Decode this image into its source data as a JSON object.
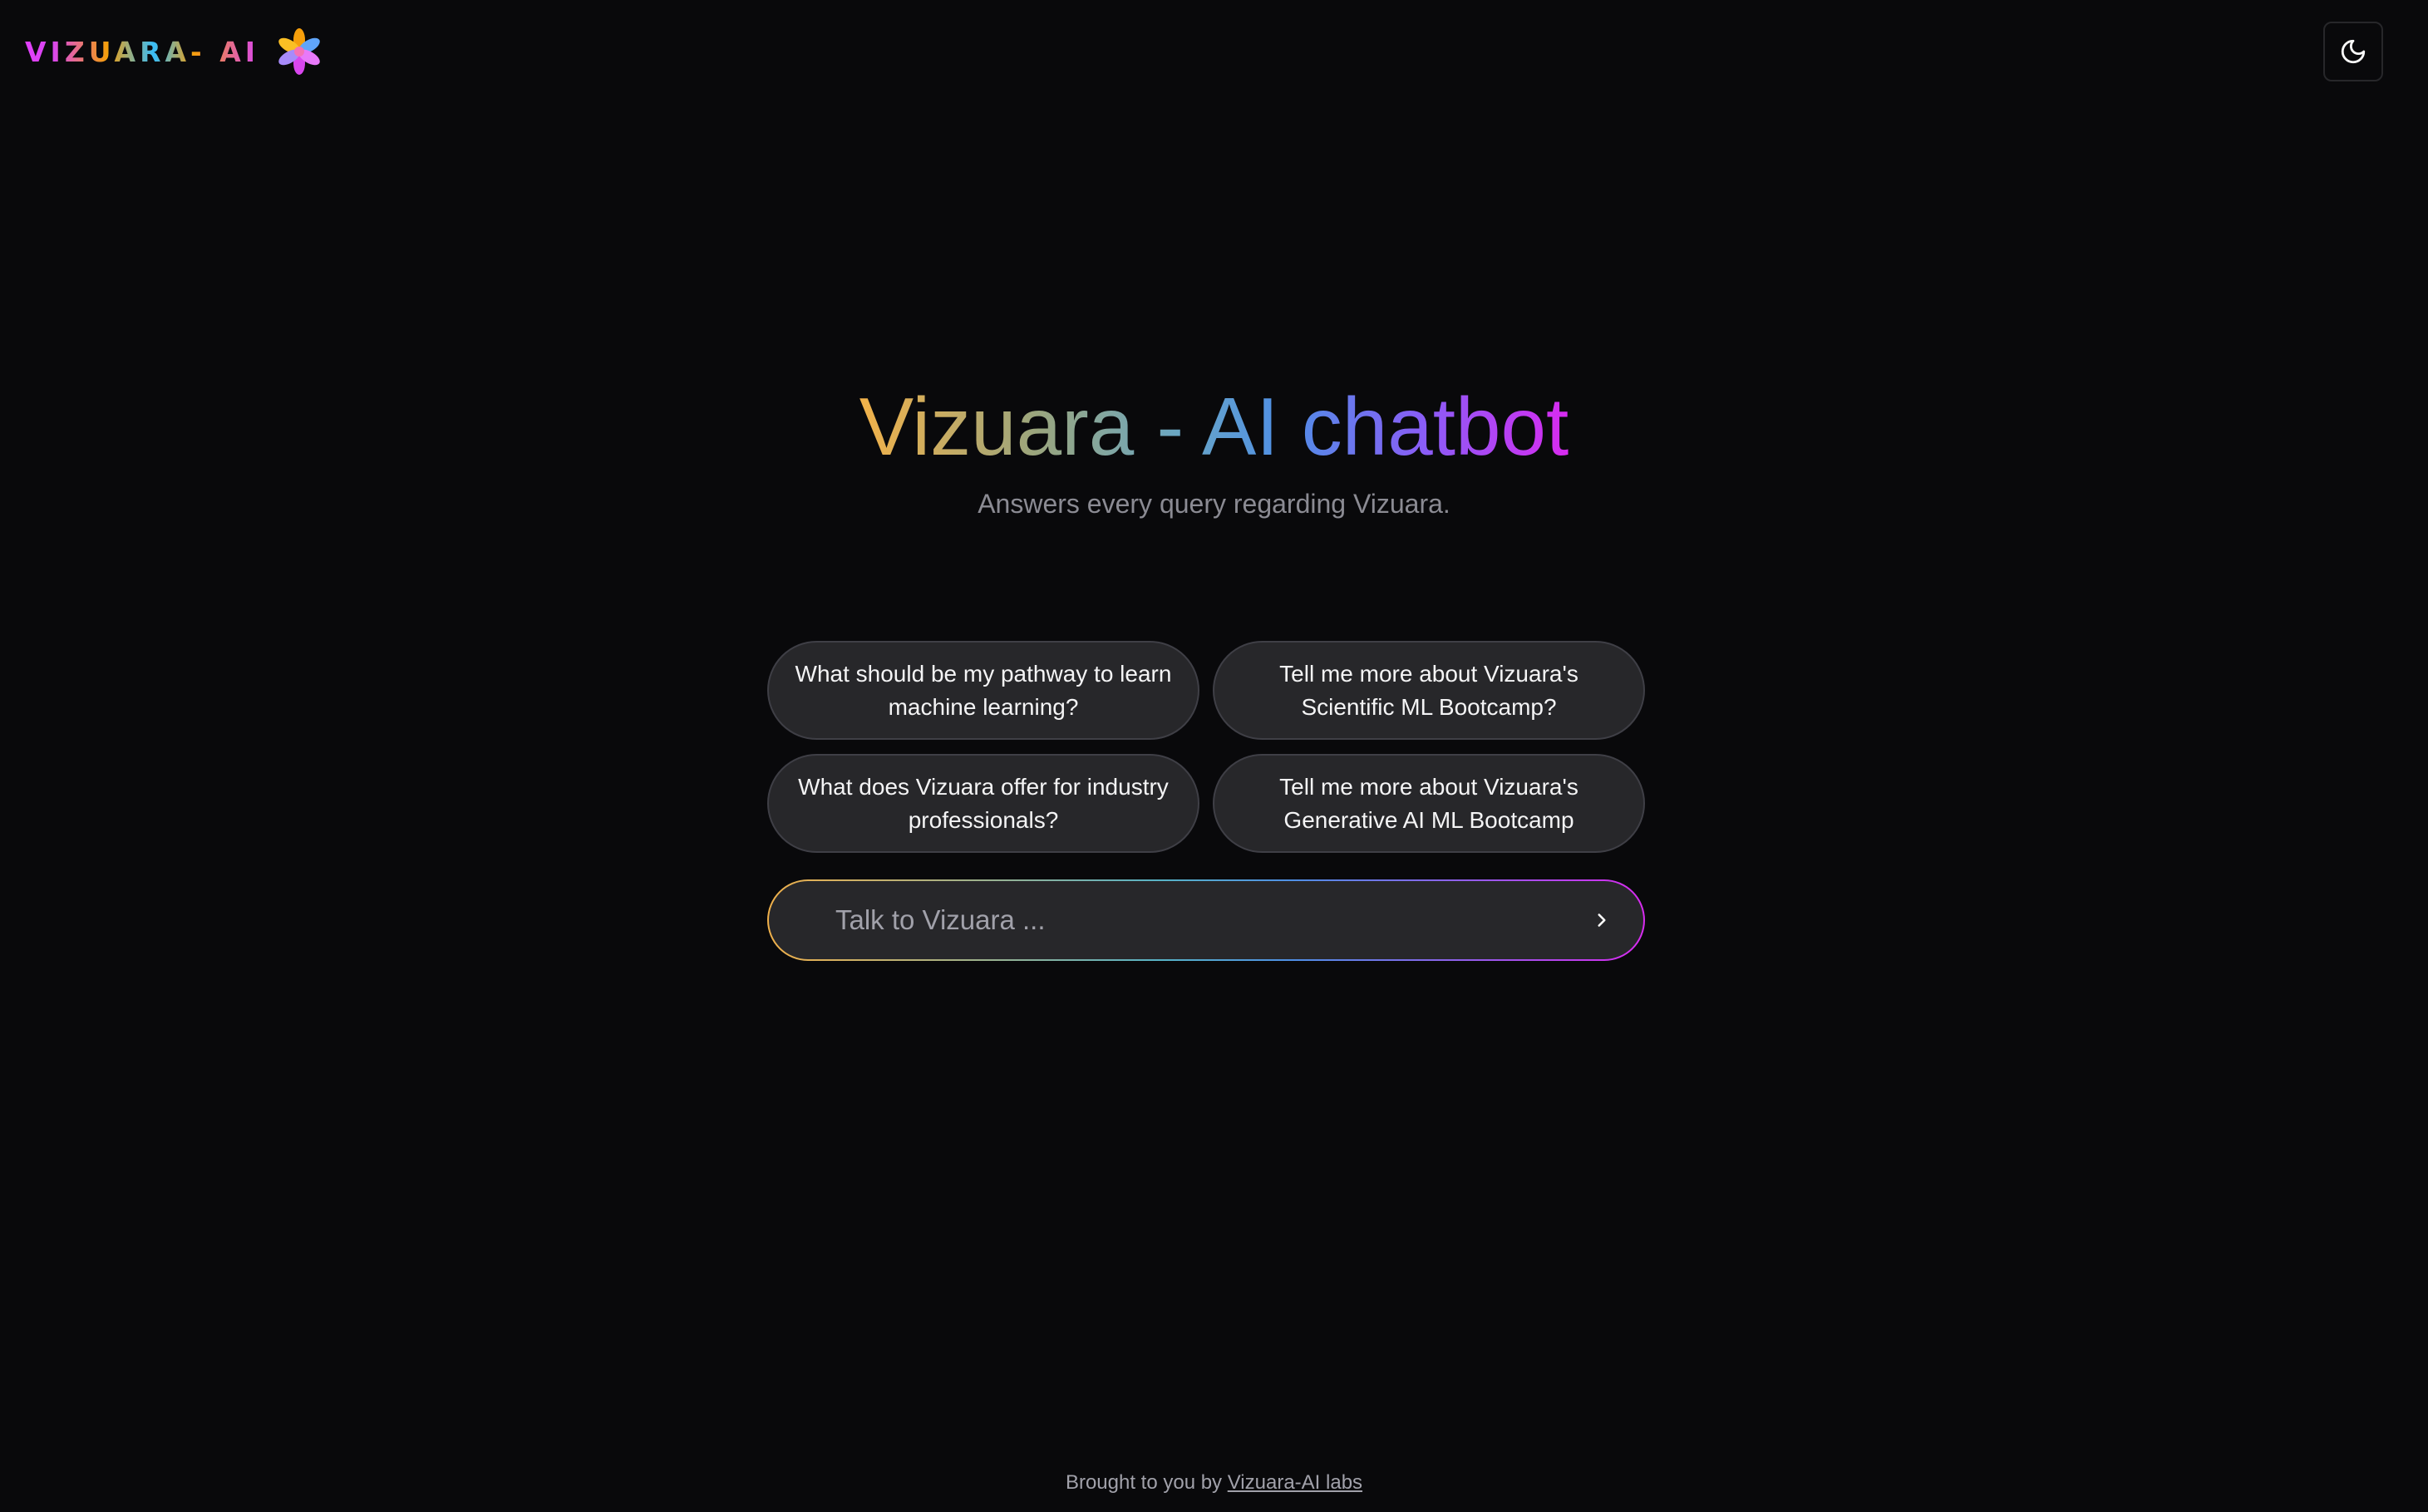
{
  "header": {
    "logo_text": "VIZUARA- AI",
    "logo_icon": "flower-logo-icon",
    "theme_toggle_icon": "moon-icon"
  },
  "hero": {
    "title": "Vizuara - AI chatbot",
    "subtitle": "Answers every query regarding Vizuara."
  },
  "suggestions": [
    "What should be my pathway to learn machine learning?",
    "Tell me more about Vizuara's Scientific ML Bootcamp?",
    "What does Vizuara offer for industry professionals?",
    "Tell me more about Vizuara's Generative AI ML Bootcamp"
  ],
  "chat": {
    "placeholder": "Talk to Vizuara ...",
    "send_icon": "chevron-right-icon"
  },
  "footer": {
    "prefix": "Brought to you by ",
    "link_label": "Vizuara-AI labs"
  },
  "colors": {
    "background": "#09090b",
    "card": "#27272a",
    "gradient_start": "#f2b24a",
    "gradient_mid": "#4f8fe6",
    "gradient_end": "#d82bf0"
  }
}
